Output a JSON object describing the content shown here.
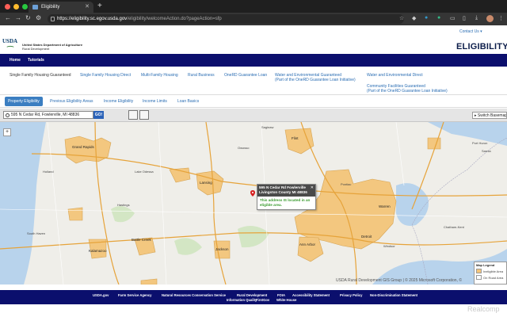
{
  "browser": {
    "tab_title": "Eligibility",
    "url_host": "https://eligibility.sc.egov.usda.gov",
    "url_path": "/eligibility/welcomeAction.do?pageAction=sfp",
    "dot_colors": [
      "#ff5f57",
      "#febc2e",
      "#28c840"
    ]
  },
  "header": {
    "logo_text": "USDA",
    "dept_line1": "United States Department of Agriculture",
    "dept_line2": "Rural Development",
    "contact_label": "Contact Us ▾",
    "title": "ELIGIBILITY"
  },
  "mainnav": {
    "home": "Home",
    "tutorials": "Tutorials"
  },
  "subnav": {
    "items": [
      "Single Family Housing Guaranteed",
      "Single Family Housing Direct",
      "Multi-Family Housing",
      "Rural Business",
      "OneRD Guarantee Loan",
      "Water and Environmental Guaranteed",
      "(Part of the OneRD Guarantee Loan Initiative)",
      "Water and Environmental Direct",
      "Community Facilities Guaranteed",
      "(Part of the OneRD Guarantee Loan Initiative)"
    ]
  },
  "tabs": [
    "Property Eligibility",
    "Previous Eligibility Areas",
    "Income Eligibility",
    "Income Limits",
    "Loan Basics"
  ],
  "map_toolbar": {
    "search_value": "595 N Cedar Rd, Fowlerville, MI 48836",
    "go_label": "GO!",
    "switch_basemap": "▸ Switch Basemap"
  },
  "popup": {
    "line1": "595 N Cedar Rd Fowlerville",
    "line2": "Livingston County MI 48836",
    "message": "This address IS located in an eligible area."
  },
  "legend": {
    "title": "Map Legend",
    "ineligible": "Ineligible Area",
    "on_road": "On Road Area",
    "ineligible_color": "#f4c57a"
  },
  "attribution": "USDA Rural Development GIS Group | © 2025 Microsoft Corporation, ©",
  "map_labels": {
    "grand_rapids": "Grand Rapids",
    "lansing": "Lansing",
    "ann_arbor": "Ann Arbor",
    "detroit": "Detroit",
    "flint": "Flint",
    "warren": "Warren",
    "kalamazoo": "Kalamazoo",
    "battle_creek": "Battle Creek",
    "jackson": "Jackson",
    "saginaw": "Saginaw",
    "owosso": "Owosso",
    "chatham_kent": "Chatham-Kent",
    "windsor": "Windsor",
    "pontiac": "Pontiac",
    "port_huron": "Port Huron",
    "sarnia": "Sarnia",
    "lake_odessa": "Lake Odessa",
    "hastings": "Hastings",
    "holland": "Holland",
    "south_haven": "South Haven"
  },
  "footer": {
    "links": [
      "USDA.gov",
      "Farm Service Agency",
      "Natural Resources Conservation Service",
      "Rural Development",
      "FOIA",
      "Accessibility Statement",
      "Privacy Policy",
      "Non-Discrimination Statement"
    ],
    "links2": [
      "Information Quality",
      "FirstGov",
      "White House"
    ]
  },
  "watermark": "Realcomp"
}
